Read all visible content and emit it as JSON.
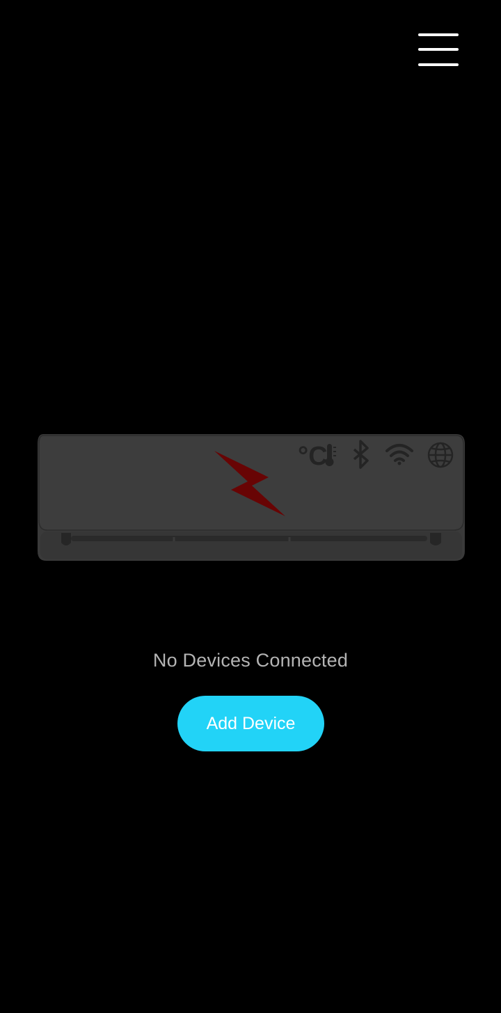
{
  "header": {
    "menu_icon": "hamburger-menu-icon"
  },
  "device_illustration": {
    "type": "air-conditioner-unit",
    "body_color": "#3b3b3b",
    "logo_color": "#6a0404",
    "temperature_unit": "°C",
    "status_icons": [
      "thermometer-icon",
      "bluetooth-icon",
      "wifi-icon",
      "globe-icon"
    ]
  },
  "main": {
    "status_text": "No Devices Connected",
    "add_device_label": "Add Device"
  },
  "colors": {
    "background": "#000000",
    "accent": "#22d3f7",
    "status_text": "#b4b4b4"
  }
}
